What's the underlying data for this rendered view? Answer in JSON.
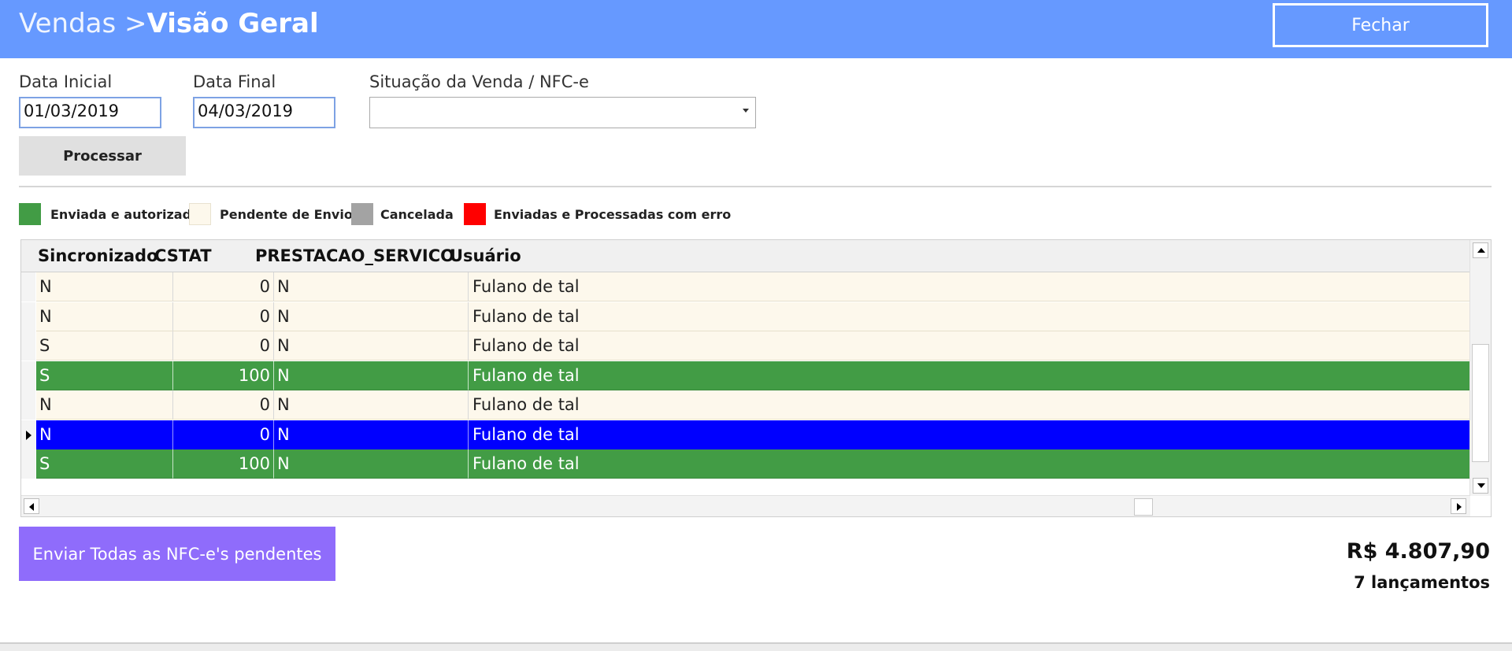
{
  "header": {
    "breadcrumb": "Vendas >",
    "title": "Visão Geral",
    "close_label": "Fechar",
    "color": "#6699ff"
  },
  "filters": {
    "start_date_label": "Data Inicial",
    "start_date_value": "01/03/2019",
    "end_date_label": "Data Final",
    "end_date_value": "04/03/2019",
    "status_label": "Situação da Venda / NFC-e",
    "status_value": "",
    "process_label": "Processar"
  },
  "legend": [
    {
      "label": "Enviada e autorizada",
      "color": "#429c45"
    },
    {
      "label": "Pendente de Envio",
      "color": "#fdf8ec"
    },
    {
      "label": "Cancelada",
      "color": "#a3a3a3"
    },
    {
      "label": "Enviadas e Processadas com erro",
      "color": "#ff0000"
    }
  ],
  "grid": {
    "columns": [
      "Sincronizado",
      "CSTAT",
      "PRESTACAO_SERVICO",
      "Usuário"
    ],
    "rows": [
      {
        "sincronizado": "N",
        "cstat": "0",
        "prestacao": "N",
        "usuario": "Fulano de tal",
        "status": "pending"
      },
      {
        "sincronizado": "N",
        "cstat": "0",
        "prestacao": "N",
        "usuario": "Fulano de tal",
        "status": "pending"
      },
      {
        "sincronizado": "S",
        "cstat": "0",
        "prestacao": "N",
        "usuario": "Fulano de tal",
        "status": "pending"
      },
      {
        "sincronizado": "S",
        "cstat": "100",
        "prestacao": "N",
        "usuario": "Fulano de tal",
        "status": "auth"
      },
      {
        "sincronizado": "N",
        "cstat": "0",
        "prestacao": "N",
        "usuario": "Fulano de tal",
        "status": "pending"
      },
      {
        "sincronizado": "N",
        "cstat": "0",
        "prestacao": "N",
        "usuario": "Fulano de tal",
        "status": "sel"
      },
      {
        "sincronizado": "S",
        "cstat": "100",
        "prestacao": "N",
        "usuario": "Fulano de tal",
        "status": "auth"
      }
    ]
  },
  "footer": {
    "send_label": "Enviar Todas as NFC-e's pendentes",
    "send_color": "#8f6cfb",
    "total": "R$ 4.807,90",
    "count": "7 lançamentos"
  }
}
